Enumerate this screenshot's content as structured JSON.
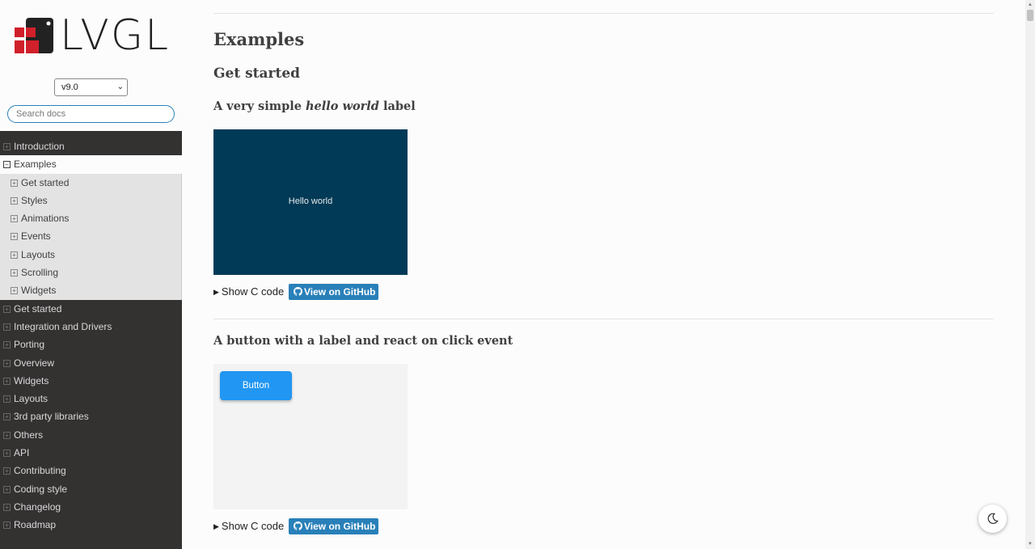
{
  "sidebar": {
    "logo_text": "LVGL",
    "version": "v9.0",
    "search_placeholder": "Search docs",
    "items": [
      {
        "label": "Introduction"
      },
      {
        "label": "Examples"
      },
      {
        "label": "Get started"
      },
      {
        "label": "Integration and Drivers"
      },
      {
        "label": "Porting"
      },
      {
        "label": "Overview"
      },
      {
        "label": "Widgets"
      },
      {
        "label": "Layouts"
      },
      {
        "label": "3rd party libraries"
      },
      {
        "label": "Others"
      },
      {
        "label": "API"
      },
      {
        "label": "Contributing"
      },
      {
        "label": "Coding style"
      },
      {
        "label": "Changelog"
      },
      {
        "label": "Roadmap"
      }
    ],
    "sub_items": [
      {
        "label": "Get started"
      },
      {
        "label": "Styles"
      },
      {
        "label": "Animations"
      },
      {
        "label": "Events"
      },
      {
        "label": "Layouts"
      },
      {
        "label": "Scrolling"
      },
      {
        "label": "Widgets"
      }
    ]
  },
  "main": {
    "title": "Examples",
    "section_title": "Get started",
    "example1": {
      "title_pre": "A very simple ",
      "title_em": "hello world",
      "title_post": " label",
      "demo_text": "Hello world",
      "show_code": "Show C code",
      "github": "View on GitHub"
    },
    "example2": {
      "title": "A button with a label and react on click event",
      "demo_button": "Button",
      "show_code": "Show C code",
      "github": "View on GitHub"
    }
  },
  "colors": {
    "sidebar_bg": "#343131",
    "demo1_bg": "#003a57",
    "demo_button": "#2196f3",
    "link_button": "#2980b9"
  }
}
